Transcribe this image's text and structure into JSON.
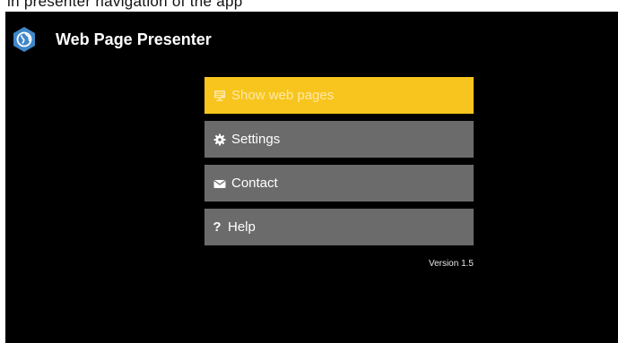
{
  "app": {
    "title": "Web Page Presenter",
    "logo_icon": "globe-icon",
    "accent_color": "#f7c51d",
    "item_color": "#6b6b6b",
    "background_color": "#000000"
  },
  "top_strip": {
    "partial_text": "in presenter navigation of the app"
  },
  "menu": {
    "items": [
      {
        "label": "Show web pages",
        "icon": "monitor-icon",
        "selected": true
      },
      {
        "label": "Settings",
        "icon": "gear-icon",
        "selected": false
      },
      {
        "label": "Contact",
        "icon": "envelope-icon",
        "selected": false
      },
      {
        "label": "Help",
        "icon": "question-icon",
        "selected": false
      }
    ]
  },
  "version": "Version 1.5"
}
